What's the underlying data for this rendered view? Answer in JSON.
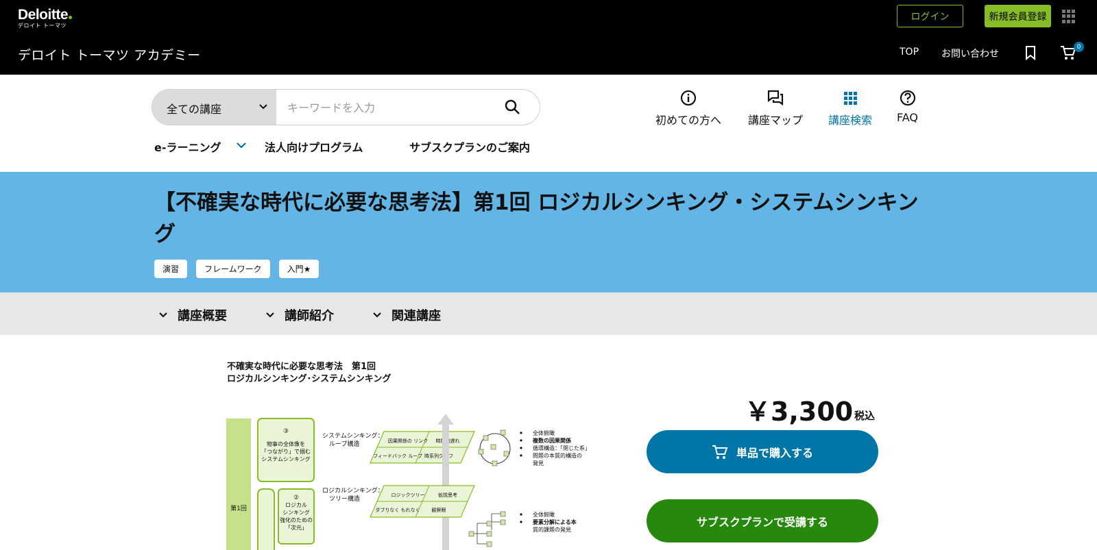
{
  "header": {
    "logo_main": "Deloitte",
    "logo_sub": "デロイト トーマツ",
    "site_title": "デロイト トーマツ アカデミー",
    "login_label": "ログイン",
    "register_label": "新規会員登録",
    "nav_top": "TOP",
    "nav_contact": "お問い合わせ",
    "cart_count": "0"
  },
  "search": {
    "category": "全ての講座",
    "placeholder": "キーワードを入力"
  },
  "quick_links": [
    {
      "label": "初めての方へ",
      "icon": "info-icon"
    },
    {
      "label": "講座マップ",
      "icon": "chat-icon"
    },
    {
      "label": "講座検索",
      "icon": "grid-icon"
    },
    {
      "label": "FAQ",
      "icon": "question-icon"
    }
  ],
  "subnav": {
    "elearning": "e-ラーニング",
    "corporate": "法人向けプログラム",
    "subscription": "サブスクプランのご案内"
  },
  "course": {
    "title": "【不確実な時代に必要な思考法】第1回 ロジカルシンキング・システムシンキング",
    "tags": [
      "演習",
      "フレームワーク",
      "入門★"
    ]
  },
  "accordion": {
    "overview": "講座概要",
    "instructor": "講師紹介",
    "related": "関連講座"
  },
  "slide": {
    "title_line1": "不確実な時代に必要な思考法　第1回",
    "title_line2": "ロジカルシンキング･システムシンキング",
    "session_label": "第1回",
    "box3_num": "③",
    "box3_lines": [
      "物事の全体像を",
      "「つながり」で掴む",
      "システムシンキング"
    ],
    "box2_num": "②",
    "box2_lines": [
      "ロジカル",
      "シンキング",
      "強化のための",
      "「次元」"
    ],
    "sys_label_1": "システムシンキング：",
    "sys_label_2": "ループ構造",
    "sys_cells": [
      "因果関係の\nリンク",
      "時間的遅れ",
      "フィードバック\nループ",
      "時系列グラフ"
    ],
    "logic_label_1": "ロジカルシンキング：",
    "logic_label_2": "ツリー構造",
    "logic_cells": [
      "ロジックツリー",
      "仮説思考",
      "ダブりなく\nもれなく",
      "観察眼"
    ],
    "sys_bullets": [
      "全体俯瞰",
      "複数の因果関係",
      "循環構造：「閉じた系」",
      "問題の本質的構造の",
      "発見"
    ],
    "logic_bullets": [
      "全体俯瞰",
      "要素分解による本",
      "質的課題の発見"
    ]
  },
  "purchase": {
    "price": "￥3,300",
    "tax": "税込",
    "buy_label": "単品で購入する",
    "subscribe_label": "サブスクプランで受講する"
  },
  "colors": {
    "deloitte_green": "#86bc25",
    "band_blue": "#62b5e5",
    "primary_blue": "#0076a8",
    "subscribe_green": "#26890d"
  }
}
